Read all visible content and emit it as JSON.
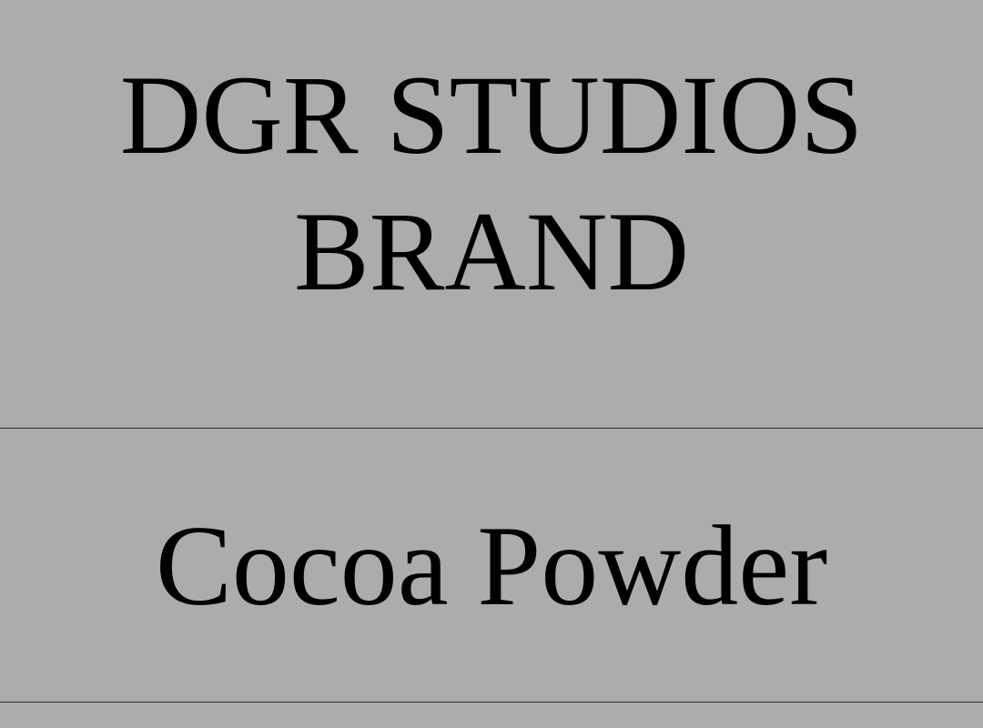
{
  "label": {
    "brand_line_1": "DGR STUDIOS",
    "brand_line_2": "BRAND",
    "product_name": "Cocoa Powder"
  },
  "colors": {
    "background": "#adabac",
    "text": "#000000",
    "divider": "#2a2a2a"
  }
}
